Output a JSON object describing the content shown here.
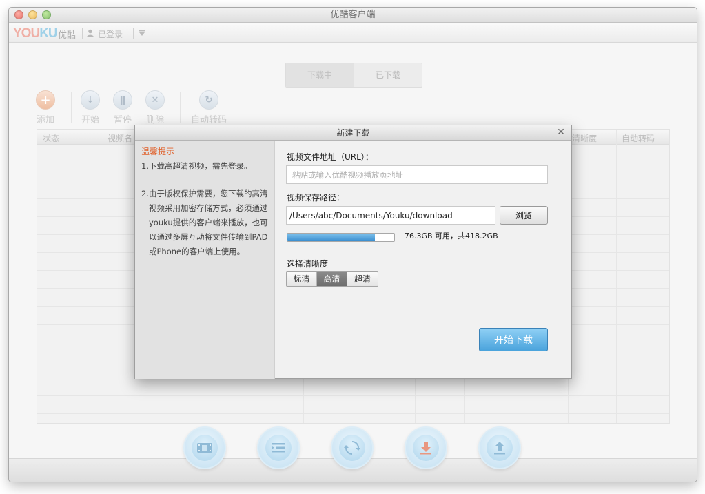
{
  "window": {
    "title": "优酷客户端"
  },
  "topbar": {
    "logo_you": "YOU",
    "logo_ku": "KU",
    "logo_cn": "优酷",
    "user_status": "已登录"
  },
  "tabs": [
    {
      "label": "下载中",
      "active": true
    },
    {
      "label": "已下载",
      "active": false
    }
  ],
  "toolbar": {
    "add": "添加",
    "start": "开始",
    "pause": "暂停",
    "delete": "删除",
    "auto_convert": "自动转码"
  },
  "table": {
    "headers": {
      "status": "状态",
      "video_name": "视频名",
      "definition": "清晰度",
      "auto_convert": "自动转码"
    }
  },
  "dialog": {
    "title": "新建下载",
    "tips_title": "温馨提示",
    "tips": [
      {
        "num": "1.",
        "text": "下载高超清视频，需先登录。"
      },
      {
        "num": "2.",
        "text": "由于版权保护需要，您下载的高清视频采用加密存储方式，必须通过youku提供的客户端来播放，也可以通过多屏互动将文件传输到PAD或Phone的客户端上使用。"
      }
    ],
    "url_label": "视频文件地址（URL）：",
    "url_placeholder": "粘贴或输入优酷视频播放页地址",
    "url_value": "",
    "path_label": "视频保存路径：",
    "path_value": "/Users/abc/Documents/Youku/download",
    "browse_label": "浏览",
    "disk_usage_fraction": 0.82,
    "disk_text": "76.3GB 可用，共418.2GB",
    "quality_label": "选择清晰度",
    "quality_options": [
      "标清",
      "高清",
      "超清"
    ],
    "quality_selected": "高清",
    "start_label": "开始下载"
  },
  "colors": {
    "accent": "#4aa3dc",
    "tips_title": "#e0602a",
    "logo_red": "#e8503a",
    "logo_blue": "#2a9fd6"
  }
}
